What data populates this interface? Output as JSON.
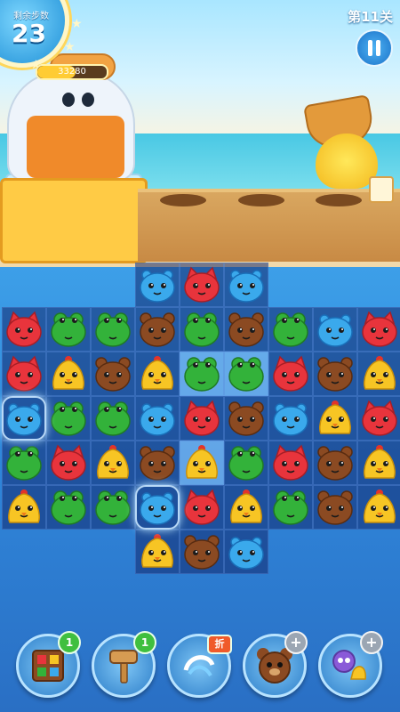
{
  "hud": {
    "moves_label": "剩余步数",
    "moves_value": "23",
    "score": "33280",
    "score_progress": 0.55,
    "level": "第11关"
  },
  "board": {
    "rows": [
      [
        "",
        "",
        "",
        "blue",
        "red",
        "blue",
        "",
        "",
        ""
      ],
      [
        "red",
        "frog",
        "frog",
        "bear",
        "frog",
        "bear",
        "frog",
        "blue",
        "red"
      ],
      [
        "red",
        "chick",
        "bear",
        "chick",
        "frog",
        "frog",
        "red",
        "bear",
        "chick"
      ],
      [
        "blue",
        "frog",
        "frog",
        "blue",
        "red",
        "bear",
        "blue",
        "chick",
        "red"
      ],
      [
        "frog",
        "red",
        "chick",
        "bear",
        "chick",
        "frog",
        "red",
        "bear",
        "chick"
      ],
      [
        "chick",
        "frog",
        "frog",
        "blue",
        "red",
        "chick",
        "frog",
        "bear",
        "chick"
      ],
      [
        "",
        "",
        "",
        "chick",
        "bear",
        "blue",
        "",
        "",
        ""
      ]
    ],
    "highlighted": [
      [
        2,
        4
      ],
      [
        2,
        5
      ],
      [
        4,
        4
      ]
    ],
    "glowing": [
      [
        3,
        0
      ],
      [
        5,
        3
      ]
    ]
  },
  "boosters": [
    {
      "name": "shuffle",
      "icon": "shuffle-icon",
      "badge": "1",
      "badge_type": "count"
    },
    {
      "name": "hammer",
      "icon": "hammer-icon",
      "badge": "1",
      "badge_type": "count"
    },
    {
      "name": "swap",
      "icon": "swap-icon",
      "badge": "折",
      "badge_type": "sale"
    },
    {
      "name": "bear-bomb",
      "icon": "bear-booster-icon",
      "badge": "+",
      "badge_type": "add"
    },
    {
      "name": "owl-chick",
      "icon": "owl-chick-icon",
      "badge": "+",
      "badge_type": "add"
    }
  ],
  "colors": {
    "red": "#e8343c",
    "blue": "#3aa9ec",
    "frog": "#33b23a",
    "bear": "#8b4a22",
    "chick": "#f7c524"
  }
}
